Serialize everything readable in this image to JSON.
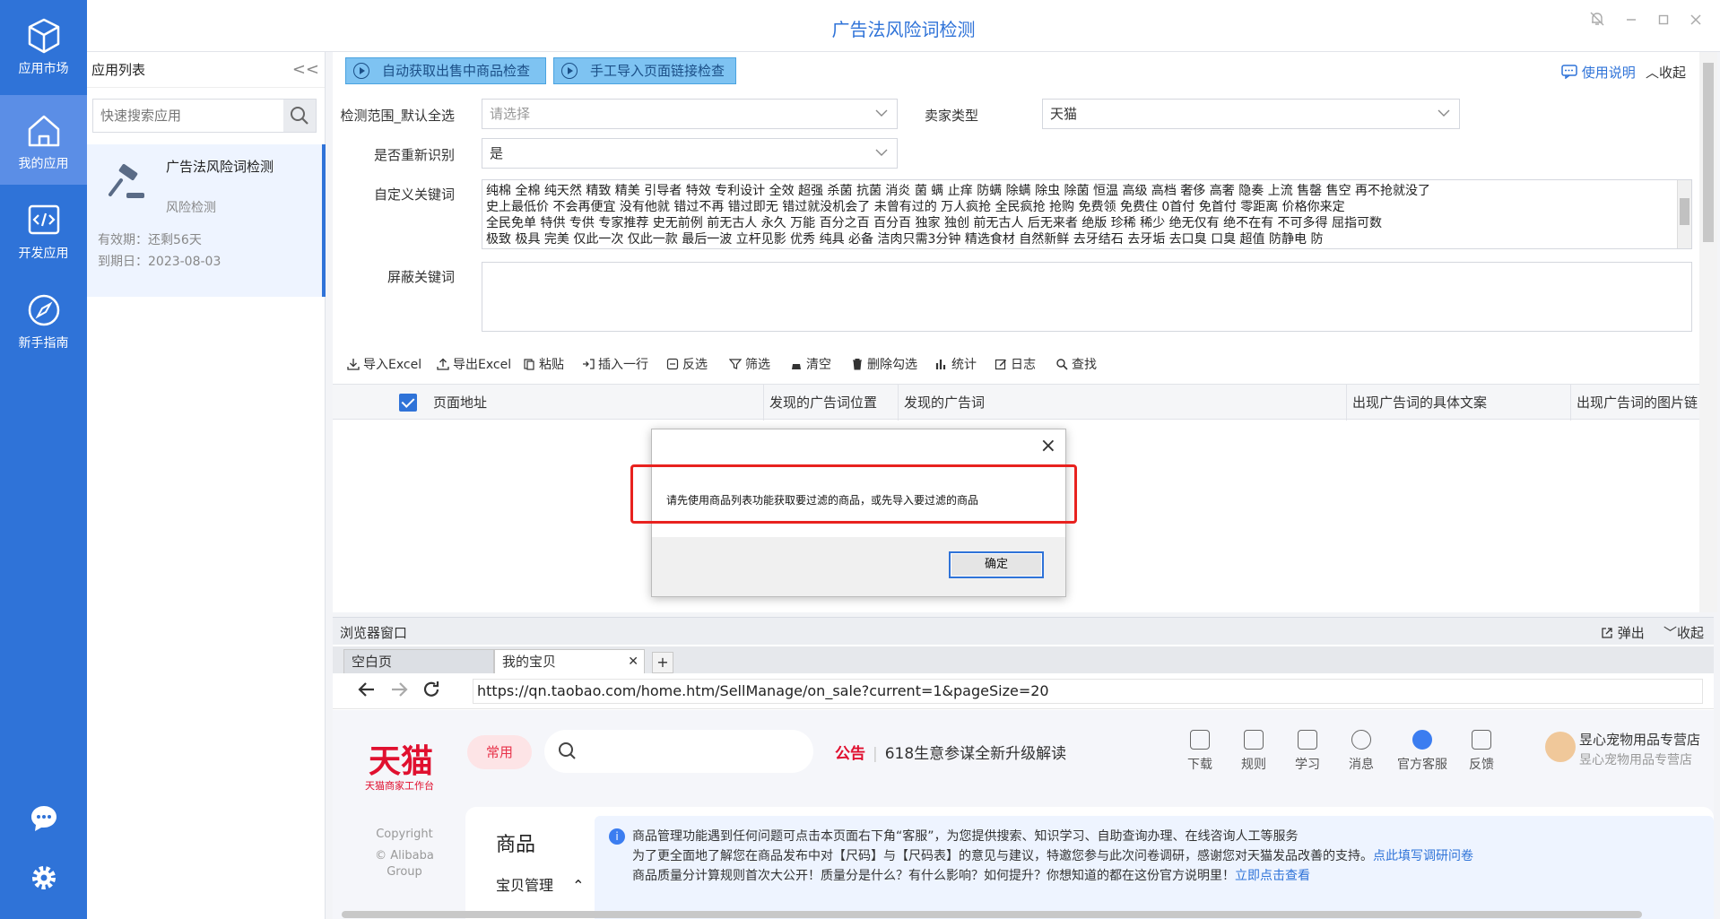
{
  "rail": {
    "items": [
      {
        "label": "应用市场",
        "icon": "cube-icon"
      },
      {
        "label": "我的应用",
        "icon": "home-icon"
      },
      {
        "label": "开发应用",
        "icon": "code-icon"
      },
      {
        "label": "新手指南",
        "icon": "compass-icon"
      }
    ]
  },
  "titlebar": {
    "title": "广告法风险词检测"
  },
  "applist": {
    "header": "应用列表",
    "collapse_glyph": "<<",
    "search_placeholder": "快速搜索应用",
    "app": {
      "name": "广告法风险词检测",
      "subtitle": "风险检测",
      "validity": "有效期：还剩56天",
      "due": "到期日：2023-08-03"
    }
  },
  "main": {
    "btn_auto": "自动获取出售中商品检查",
    "btn_manual": "手工导入页面链接检查",
    "help": "使用说明",
    "fold": "收起",
    "range_label": "检测范围_默认全选",
    "range_placeholder": "请选择",
    "seller_label": "卖家类型",
    "seller_value": "天猫",
    "reidentify_label": "是否重新识别",
    "reidentify_value": "是",
    "custom_label": "自定义关键词",
    "custom_lines": [
      "纯棉 全棉 纯天然 精致 精美 引导者 特效 专利设计 全效 超强 杀菌 抗菌 消炎 菌 螨 止痒 防螨 除螨 除虫 除菌 恒温 高级 高档 奢侈 高奢 隐奏 上流 售罄 售空 再不抢就没了",
      " 史上最低价 不会再便宜 没有他就 错过不再 错过即无 错过就没机会了 未曾有过的 万人疯抢 全民疯抢 抢购 免费领 免费住 0首付 免首付 零距离 价格你来定",
      "全民免单 特供 专供 专家推荐 史无前例 前无古人 永久 万能 百分之百 百分百 独家 独创 前无古人 后无来者 绝版 珍稀 稀少 绝无仅有 绝不在有 不可多得  屈指可数",
      " 极致 极具 完美 仅此一次 仅此一款 最后一波 立杆见影 优秀 纯具 必备 洁肉只需3分钟 精选食材 自然新鲜 去牙结石 去牙垢 去口臭 口臭 超值 防静电 防"
    ],
    "block_label": "屏蔽关键词",
    "toolbar": [
      "导入Excel",
      "导出Excel",
      "粘贴",
      "插入一行",
      "反选",
      "筛选",
      "清空",
      "删除勾选",
      "统计",
      "日志",
      "查找"
    ],
    "columns": [
      "页面地址",
      "发现的广告词位置",
      "发现的广告词",
      "出现广告词的具体文案",
      "出现广告词的图片链"
    ]
  },
  "dialog": {
    "close": "×",
    "message": "请先使用商品列表功能获取要过滤的商品，或先导入要过滤的商品",
    "ok": "确定"
  },
  "browser": {
    "header": "浏览器窗口",
    "popout": "弹出",
    "fold": "收起",
    "tabs": [
      {
        "label": "空白页"
      },
      {
        "label": "我的宝贝"
      }
    ],
    "newtab": "+",
    "url": "https://qn.taobao.com/home.htm/SellManage/on_sale?current=1&pageSize=20",
    "tmall": {
      "logo": "天猫",
      "logo_sub": "天猫商家工作台",
      "pill": "常用",
      "notice_key": "公告",
      "notice_text": "618生意参谋全新升级解读",
      "icons": [
        "下载",
        "规则",
        "学习",
        "消息",
        "官方客服",
        "反馈"
      ],
      "store": "昱心宠物用品专营店",
      "store_sub": "昱心宠物用品专营店",
      "copyright": [
        "Copyright",
        "© Alibaba",
        "Group"
      ],
      "products": "商品",
      "menu": "宝贝管理",
      "info1": "商品管理功能遇到任何问题可点击本页面右下角“客服”，为您提供搜索、知识学习、自助查询办理、在线咨询人工等服务",
      "info2": "为了更全面地了解您在商品发布中对【尺码】与【尺码表】的意见与建议，特邀您参与此次问卷调研，感谢您对天猫发品改善的支持。",
      "info2_link": "点此填写调研问卷",
      "info3": "商品质量分计算规则首次大公开！质量分是什么？有什么影响？如何提升？你想知道的都在这份官方说明里！",
      "info3_link": "立即点击查看"
    }
  }
}
